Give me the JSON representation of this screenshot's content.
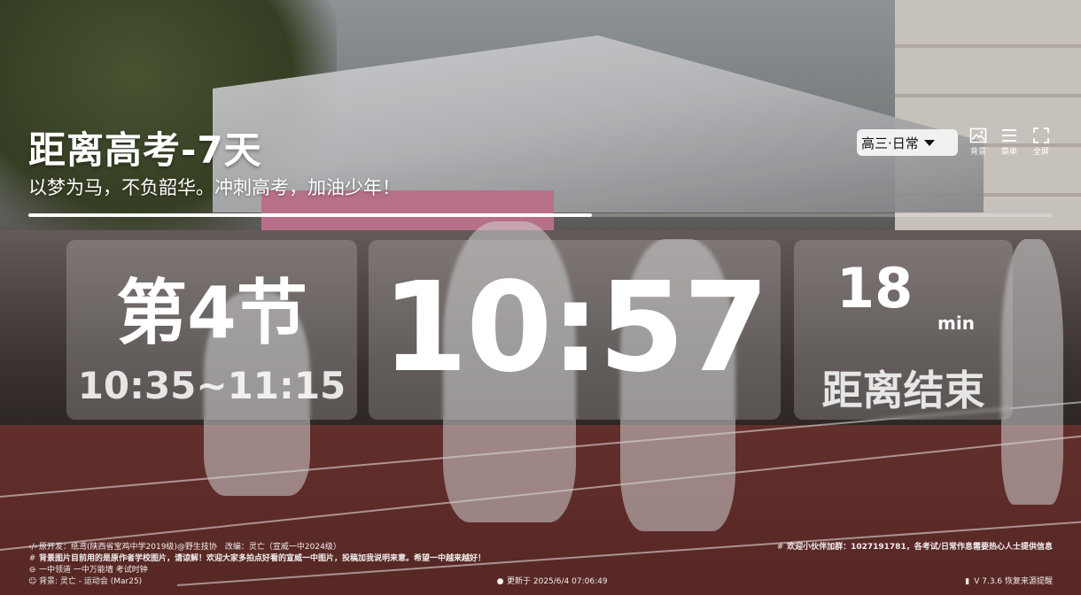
{
  "header": {
    "title": "距离高考-7天",
    "slogan": "以梦为马，不负韶华。冲刺高考，加油少年！",
    "progress_fraction": 0.55
  },
  "toolbar": {
    "mode_selected": "高三·日常",
    "background_label": "背景",
    "menu_label": "菜单",
    "fullscreen_label": "全屏"
  },
  "schedule": {
    "period": "第4节",
    "period_time": "10:35~11:15",
    "clock": "10:57",
    "remaining_value": "18",
    "remaining_unit": "min",
    "remaining_label": "距离结束"
  },
  "footer": {
    "credits": "原开发：纸鸢(陕西省宝鸡中学2019级)@野生技协　改编：灵亡（宣威一中2024级）",
    "notice": "背景图片目前用的是原作者学校图片，请谅解！欢迎大家多拍点好看的宣威一中图片，投稿加我说明来意。希望一中越来越好！",
    "links": "一中领道 一中万能墙 考试时钟",
    "background_credit": "背景: 灵亡 - 运动会 (Mar25)",
    "recruit": "欢迎小伙伴加群：1027191781，各考试/日常作息需要热心人士提供信息",
    "updated": "更新于 2025/6/4 07:06:49",
    "version": "V 7.3.6 恢复来源提醒"
  },
  "colors": {
    "text": "#ffffff",
    "card_bg": "rgba(200,200,200,0.28)",
    "track": "#5e2b28"
  }
}
